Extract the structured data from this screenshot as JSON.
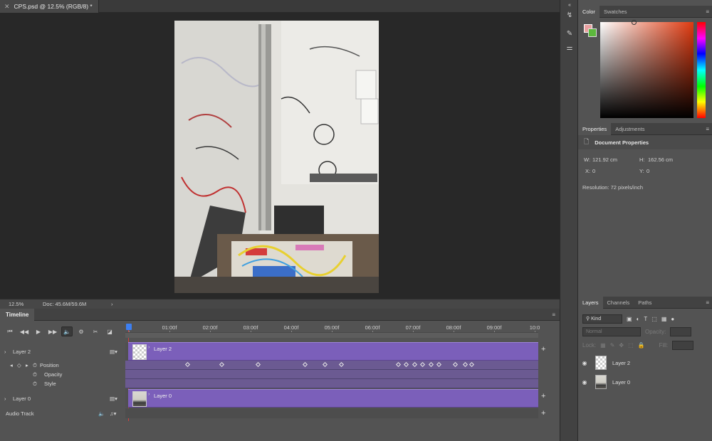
{
  "document": {
    "tab_title": "CPS.psd @ 12.5% (RGB/8) *",
    "close_icon": "close-icon",
    "zoom": "12.5%",
    "doc_info": "Doc: 45.6M/59.6M",
    "status_arrow": "›"
  },
  "timeline": {
    "title": "Timeline",
    "menu_icon": "≡",
    "ruler_labels": [
      "01:00f",
      "02:00f",
      "03:00f",
      "04:00f",
      "05:00f",
      "06:00f",
      "07:00f",
      "08:00f",
      "09:00f",
      "10:0"
    ],
    "controls": {
      "first": "⏮",
      "prev": "◀◀",
      "play": "▶",
      "next": "▶▶",
      "audio": "🔈",
      "settings": "⚙",
      "split": "✂",
      "transition": "◪"
    },
    "rows": {
      "layer2": {
        "label": "Layer 2",
        "clip_label": "Layer 2"
      },
      "position": {
        "label": "Position"
      },
      "opacity": {
        "label": "Opacity"
      },
      "style": {
        "label": "Style"
      },
      "layer0": {
        "label": "Layer 0",
        "clip_label": "Layer 0"
      },
      "audio": {
        "label": "Audio Track"
      }
    },
    "position_keyframes_seconds": [
      1.45,
      2.3,
      3.2,
      4.35,
      4.85,
      5.25,
      6.65,
      6.85,
      7.05,
      7.25,
      7.45,
      7.65,
      8.05,
      8.3,
      8.45
    ],
    "plus": "+"
  },
  "panels": {
    "color_tabs": [
      "Color",
      "Swatches"
    ],
    "properties_tabs": [
      "Properties",
      "Adjustments"
    ],
    "properties": {
      "heading": "Document Properties",
      "w_label": "W:",
      "w_value": "121.92 cm",
      "h_label": "H:",
      "h_value": "162.56 cm",
      "x_label": "X:",
      "x_value": "0",
      "y_label": "Y:",
      "y_value": "0",
      "resolution": "Resolution: 72 pixels/inch"
    },
    "layers_tabs": [
      "Layers",
      "Channels",
      "Paths"
    ],
    "layers": {
      "kind": "Kind",
      "blend_mode": "Normal",
      "opacity_label": "Opacity:",
      "lock_label": "Lock:",
      "fill_label": "Fill:",
      "items": [
        {
          "name": "Layer 2"
        },
        {
          "name": "Layer 0"
        }
      ]
    },
    "colors": {
      "foreground": "#e8a0a0",
      "background": "#5cb83c",
      "clip": "#7b5fba"
    }
  }
}
